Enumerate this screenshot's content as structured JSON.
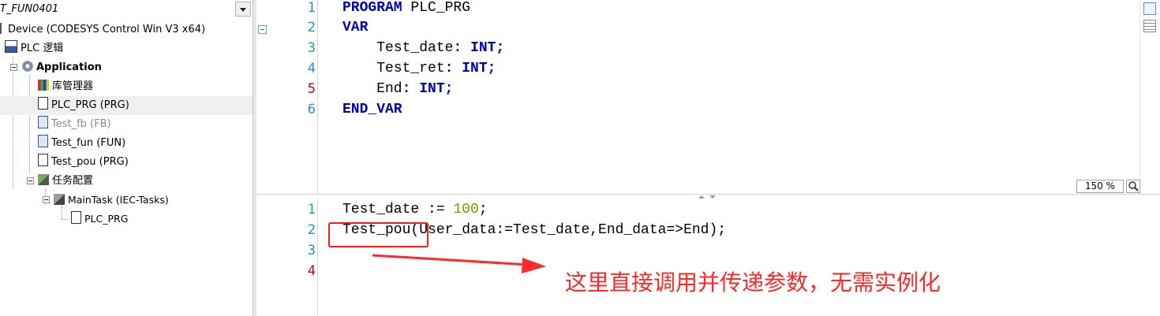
{
  "tree": {
    "header_title": "T_FUN0401",
    "nodes": [
      {
        "label": "Device (CODESYS Control Win V3 x64)",
        "icon": "device-icon"
      },
      {
        "label": "PLC 逻辑",
        "icon": "plc-logic-icon"
      },
      {
        "label": "Application",
        "icon": "gear-icon"
      },
      {
        "label": "库管理器",
        "icon": "library-icon"
      },
      {
        "label": "PLC_PRG (PRG)",
        "icon": "program-icon"
      },
      {
        "label": "Test_fb (FB)",
        "icon": "function-block-icon"
      },
      {
        "label": "Test_fun (FUN)",
        "icon": "function-icon"
      },
      {
        "label": "Test_pou (PRG)",
        "icon": "program-icon"
      },
      {
        "label": "任务配置",
        "icon": "task-config-icon"
      },
      {
        "label": "MainTask (IEC-Tasks)",
        "icon": "task-icon"
      },
      {
        "label": "PLC_PRG",
        "icon": "program-call-icon"
      }
    ]
  },
  "declaration": {
    "line_numbers": [
      "1",
      "2",
      "3",
      "4",
      "5",
      "6"
    ],
    "lines": [
      {
        "kw": "PROGRAM",
        "rest": " PLC_PRG"
      },
      {
        "kw": "VAR",
        "rest": ""
      },
      {
        "name": "    Test_date",
        "colon": ":",
        "type": "INT",
        "semi": ";"
      },
      {
        "name": "    Test_ret",
        "colon": ":",
        "type": "INT",
        "semi": ";"
      },
      {
        "name": "    End",
        "colon": ":",
        "type": "INT",
        "semi": ";"
      },
      {
        "kw": "END_VAR",
        "rest": ""
      }
    ]
  },
  "implementation": {
    "line_numbers": [
      "1",
      "2",
      "3",
      "4"
    ],
    "line1_pre": "Test_date := ",
    "line1_num": "100",
    "line1_post": ";",
    "line2": "Test_pou(User_data:=Test_date,End_data=>End);"
  },
  "zoom_level": "150 %",
  "annotation": {
    "text": "这里直接调用并传递参数，无需实例化",
    "color": "#ff2a2a"
  },
  "colors": {
    "keyword": "#0000b0",
    "line_number": "#2b91af",
    "number_literal": "#8a8a00"
  }
}
